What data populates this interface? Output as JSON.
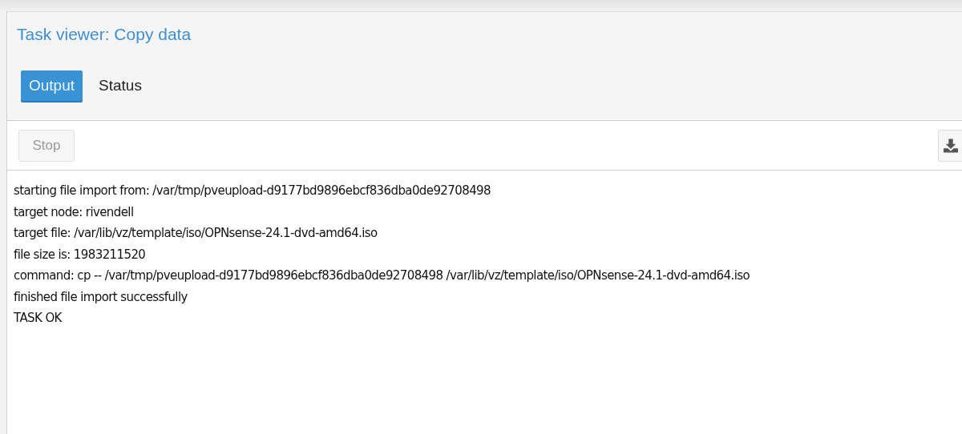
{
  "window": {
    "title": "Task viewer: Copy data"
  },
  "tabs": [
    {
      "label": "Output",
      "selected": true
    },
    {
      "label": "Status",
      "selected": false
    }
  ],
  "toolbar": {
    "stop_button": {
      "label": "Stop",
      "disabled": true
    }
  },
  "log": [
    "starting file import from: /var/tmp/pveupload-d9177bd9896ebcf836dba0de92708498",
    "target node: rivendell",
    "target file: /var/lib/vz/template/iso/OPNsense-24.1-dvd-amd64.iso",
    "file size is: 1983211520",
    "command: cp -- /var/tmp/pveupload-d9177bd9896ebcf836dba0de92708498 /var/lib/vz/template/iso/OPNsense-24.1-dvd-amd64.iso",
    "finished file import successfully",
    "TASK OK"
  ]
}
